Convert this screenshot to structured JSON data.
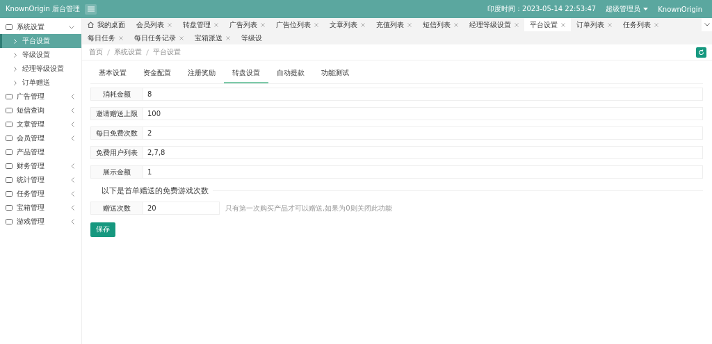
{
  "header": {
    "title": "KnownOrigin 后台管理",
    "time": "印度时间：2023-05-14 22:53:47",
    "user": "超级管理员",
    "site": "KnownOrigin"
  },
  "sidebar": {
    "items": [
      {
        "label": "系统设置",
        "expanded": true,
        "expandable": true,
        "children": [
          {
            "label": "平台设置",
            "selected": true
          },
          {
            "label": "等级设置",
            "selected": false
          },
          {
            "label": "经理等级设置",
            "selected": false
          },
          {
            "label": "订单赠送",
            "selected": false
          }
        ]
      },
      {
        "label": "广告管理",
        "expanded": false,
        "expandable": true
      },
      {
        "label": "短信查询",
        "expanded": false,
        "expandable": true
      },
      {
        "label": "文章管理",
        "expanded": false,
        "expandable": true
      },
      {
        "label": "会员管理",
        "expanded": false,
        "expandable": true
      },
      {
        "label": "产品管理",
        "expandable": false
      },
      {
        "label": "财务管理",
        "expanded": false,
        "expandable": true
      },
      {
        "label": "统计管理",
        "expanded": false,
        "expandable": true
      },
      {
        "label": "任务管理",
        "expanded": false,
        "expandable": true
      },
      {
        "label": "宝箱管理",
        "expanded": false,
        "expandable": true
      },
      {
        "label": "游戏管理",
        "expanded": false,
        "expandable": true
      }
    ]
  },
  "page_tabs": [
    {
      "label": "我的桌面",
      "selected": false,
      "closable": false
    },
    {
      "label": "会员列表",
      "selected": false,
      "closable": true
    },
    {
      "label": "转盘管理",
      "selected": false,
      "closable": true
    },
    {
      "label": "广告列表",
      "selected": false,
      "closable": true
    },
    {
      "label": "广告位列表",
      "selected": false,
      "closable": true
    },
    {
      "label": "文章列表",
      "selected": false,
      "closable": true
    },
    {
      "label": "充值列表",
      "selected": false,
      "closable": true
    },
    {
      "label": "短信列表",
      "selected": false,
      "closable": true
    },
    {
      "label": "经理等级设置",
      "selected": false,
      "closable": true
    },
    {
      "label": "平台设置",
      "selected": true,
      "closable": true
    },
    {
      "label": "订单列表",
      "selected": false,
      "closable": true
    },
    {
      "label": "任务列表",
      "selected": false,
      "closable": true
    },
    {
      "label": "每日任务",
      "selected": false,
      "closable": true
    },
    {
      "label": "每日任务记录",
      "selected": false,
      "closable": true
    },
    {
      "label": "宝箱派送",
      "selected": false,
      "closable": true
    },
    {
      "label": "等级设",
      "selected": false,
      "closable": false
    }
  ],
  "breadcrumb": [
    "首页",
    "系统设置",
    "平台设置"
  ],
  "form_tabs": [
    {
      "label": "基本设置",
      "selected": false
    },
    {
      "label": "资金配置",
      "selected": false
    },
    {
      "label": "注册奖励",
      "selected": false
    },
    {
      "label": "转盘设置",
      "selected": true
    },
    {
      "label": "自动提款",
      "selected": false
    },
    {
      "label": "功能测试",
      "selected": false
    }
  ],
  "fields": [
    {
      "label": "消耗金额",
      "value": "8"
    },
    {
      "label": "邀请赠送上限",
      "value": "100"
    },
    {
      "label": "每日免费次数",
      "value": "2"
    },
    {
      "label": "免费用户列表",
      "value": "2,7,8"
    },
    {
      "label": "展示金额",
      "value": "1"
    }
  ],
  "section_title": "以下是首单赠送的免费游戏次数",
  "gift_field": {
    "label": "赠送次数",
    "value": "20",
    "hint": "只有第一次购买产品才可以赠送,如果为0则关闭此功能"
  },
  "save_button": "保存"
}
